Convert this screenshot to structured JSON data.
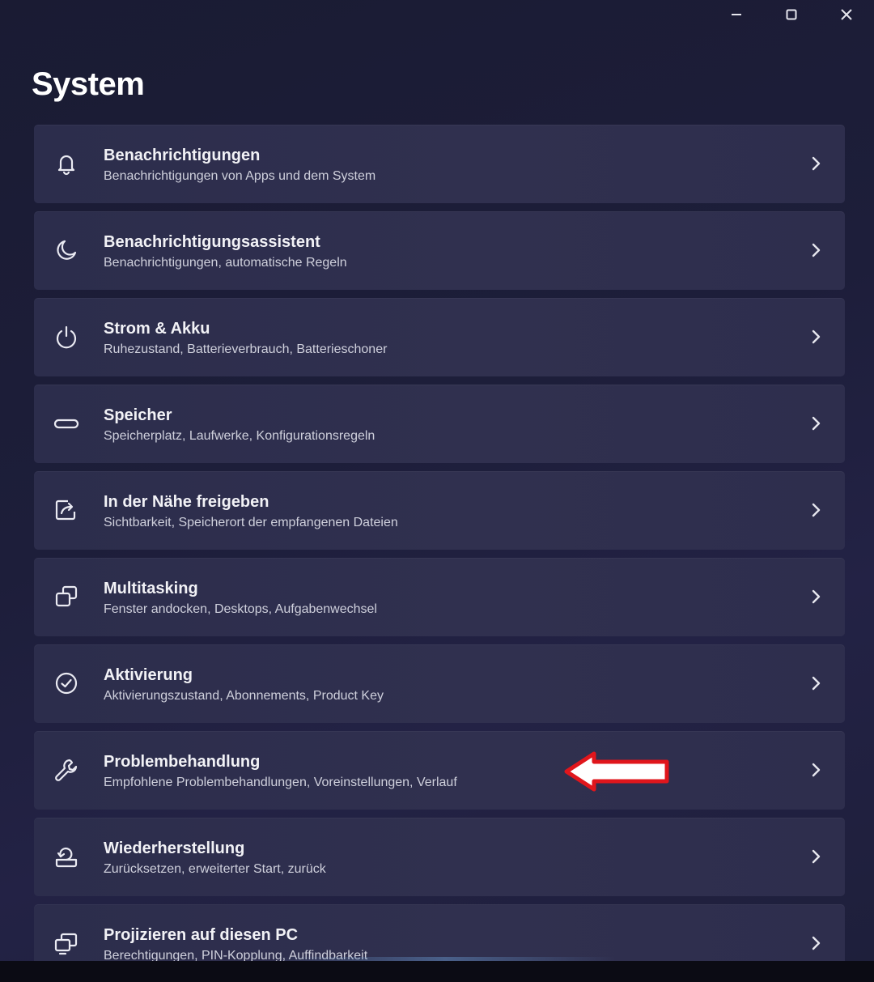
{
  "window": {
    "title": "System",
    "controls": {
      "minimize": "minimize-icon",
      "maximize": "maximize-icon",
      "close": "close-icon"
    }
  },
  "items": [
    {
      "icon": "bell-icon",
      "title": "Benachrichtigungen",
      "subtitle": "Benachrichtigungen von Apps und dem System"
    },
    {
      "icon": "moon-icon",
      "title": "Benachrichtigungsassistent",
      "subtitle": "Benachrichtigungen, automatische Regeln"
    },
    {
      "icon": "power-icon",
      "title": "Strom & Akku",
      "subtitle": "Ruhezustand, Batterieverbrauch, Batterieschoner"
    },
    {
      "icon": "storage-icon",
      "title": "Speicher",
      "subtitle": "Speicherplatz, Laufwerke, Konfigurationsregeln"
    },
    {
      "icon": "share-icon",
      "title": "In der Nähe freigeben",
      "subtitle": "Sichtbarkeit, Speicherort der empfangenen Dateien"
    },
    {
      "icon": "multitasking-icon",
      "title": "Multitasking",
      "subtitle": "Fenster andocken, Desktops, Aufgabenwechsel"
    },
    {
      "icon": "check-circle-icon",
      "title": "Aktivierung",
      "subtitle": "Aktivierungszustand, Abonnements, Product Key"
    },
    {
      "icon": "wrench-icon",
      "title": "Problembehandlung",
      "subtitle": "Empfohlene Problembehandlungen, Voreinstellungen, Verlauf"
    },
    {
      "icon": "recovery-icon",
      "title": "Wiederherstellung",
      "subtitle": "Zurücksetzen, erweiterter Start, zurück"
    },
    {
      "icon": "project-icon",
      "title": "Projizieren auf diesen PC",
      "subtitle": "Berechtigungen, PIN-Kopplung, Auffindbarkeit"
    }
  ],
  "annotation": {
    "type": "red-arrow-icon",
    "target_item": "Problembehandlung",
    "color": "#e0161c"
  },
  "colors": {
    "background": "#1c1d38",
    "card": "#2e2e4d",
    "text": "#f2f2f6",
    "subtext": "#cfd0dc"
  }
}
